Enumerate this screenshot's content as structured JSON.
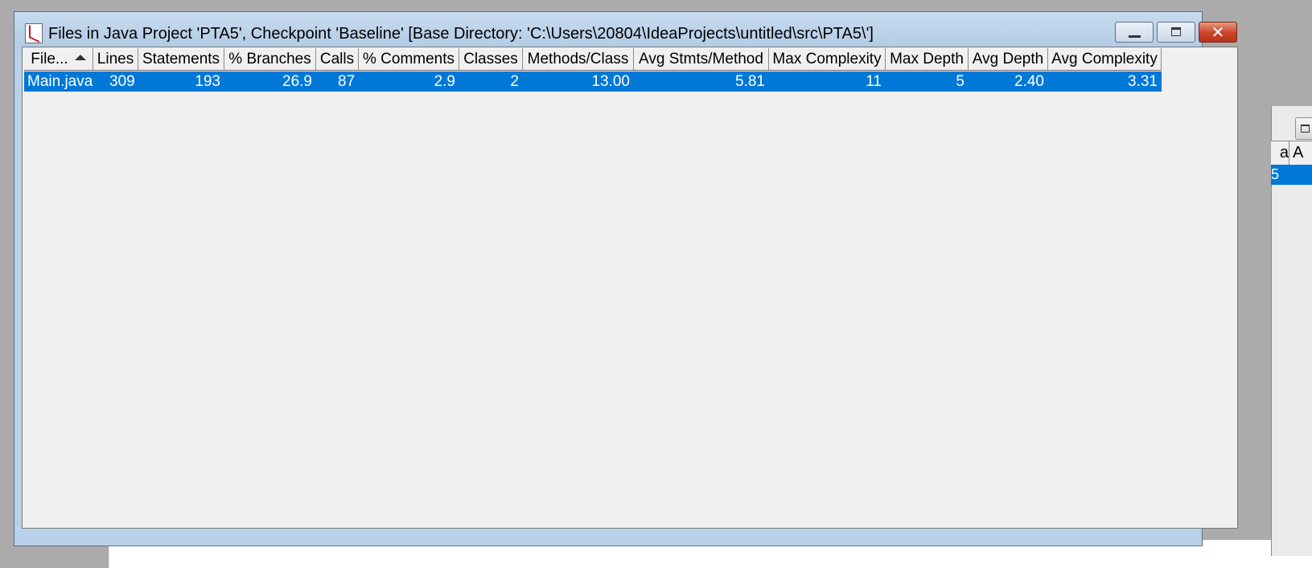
{
  "window": {
    "title": "Files in Java Project 'PTA5', Checkpoint 'Baseline'  [Base Directory: 'C:\\Users\\20804\\IdeaProjects\\untitled\\src\\PTA5\\']",
    "close_glyph": "✕"
  },
  "table": {
    "columns": [
      "File...",
      "Lines",
      "Statements",
      "% Branches",
      "Calls",
      "% Comments",
      "Classes",
      "Methods/Class",
      "Avg Stmts/Method",
      "Max Complexity",
      "Max Depth",
      "Avg Depth",
      "Avg Complexity"
    ],
    "sorted_column": "File...",
    "rows": [
      [
        "Main.java",
        "309",
        "193",
        "26.9",
        "87",
        "2.9",
        "2",
        "13.00",
        "5.81",
        "11",
        "5",
        "2.40",
        "3.31"
      ]
    ],
    "selected_row_color": "#0078d7"
  },
  "background_window": {
    "header_cell_1": "a",
    "header_cell_2": "A",
    "row_text": "5"
  }
}
